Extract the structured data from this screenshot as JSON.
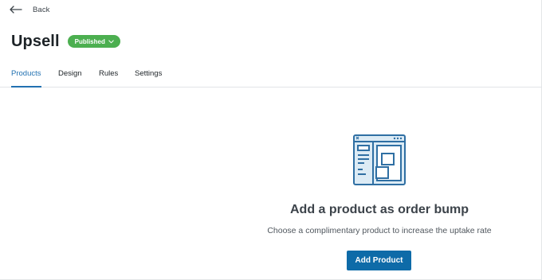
{
  "header": {
    "back_label": "Back",
    "title": "Upsell",
    "status_badge": "Published"
  },
  "tabs": [
    {
      "label": "Products",
      "active": true
    },
    {
      "label": "Design",
      "active": false
    },
    {
      "label": "Rules",
      "active": false
    },
    {
      "label": "Settings",
      "active": false
    }
  ],
  "empty_state": {
    "illustration": "browser-window-layout-icon",
    "heading": "Add a product as order bump",
    "description": "Choose a complimentary product to increase the uptake rate",
    "button_label": "Add Product"
  },
  "colors": {
    "accent": "#2271b1",
    "published_badge": "#4caf50",
    "primary_button": "#0e6ba8"
  }
}
